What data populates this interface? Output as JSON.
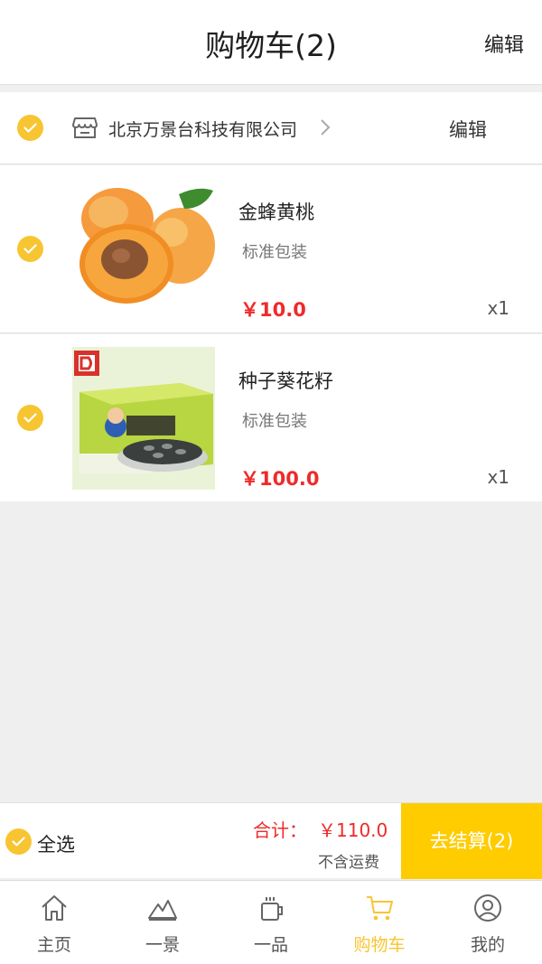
{
  "header": {
    "title": "购物车(2)",
    "edit_label": "编辑"
  },
  "store": {
    "name": "北京万景台科技有限公司",
    "edit_label": "编辑",
    "icon": "shop-icon"
  },
  "items": [
    {
      "name": "金蜂黄桃",
      "spec": "标准包装",
      "price": "￥10.0",
      "qty": "x1",
      "checked": true
    },
    {
      "name": "种子葵花籽",
      "spec": "标准包装",
      "price": "￥100.0",
      "qty": "x1",
      "checked": true
    }
  ],
  "checkout": {
    "select_all_label": "全选",
    "total_label": "合计：",
    "total_value": "￥110.0",
    "shipping_note": "不含运费",
    "pay_label": "去结算(2)"
  },
  "tabs": [
    {
      "label": "主页",
      "icon": "home-icon",
      "active": false
    },
    {
      "label": "一景",
      "icon": "mountain-icon",
      "active": false
    },
    {
      "label": "一品",
      "icon": "cup-icon",
      "active": false
    },
    {
      "label": "购物车",
      "icon": "cart-icon",
      "active": true
    },
    {
      "label": "我的",
      "icon": "profile-icon",
      "active": false
    }
  ],
  "colors": {
    "accent": "#f7c531",
    "pay_button": "#ffcc00",
    "price": "#ef2a2a"
  }
}
